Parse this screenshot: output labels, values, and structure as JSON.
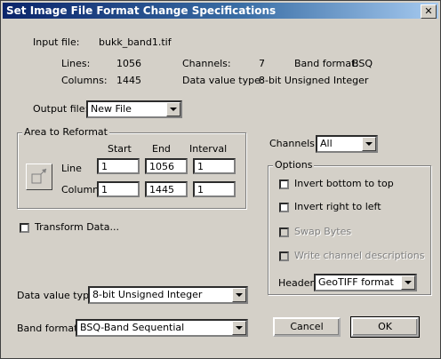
{
  "title": "Set Image File Format Change Specifications",
  "input_file": {
    "label": "Input file:",
    "value": "bukk_band1.tif"
  },
  "info": {
    "lines_label": "Lines:",
    "lines_value": "1056",
    "channels_label": "Channels:",
    "channels_value": "7",
    "band_format_label": "Band format:",
    "band_format_value": "BSQ",
    "columns_label": "Columns:",
    "columns_value": "1445",
    "data_value_type_label": "Data value type:",
    "data_value_type_value": "8-bit Unsigned Integer"
  },
  "output_file": {
    "label": "Output file:",
    "value": "New File"
  },
  "area": {
    "title": "Area to Reformat",
    "start_header": "Start",
    "end_header": "End",
    "interval_header": "Interval",
    "line_label": "Line",
    "line_start": "1",
    "line_end": "1056",
    "line_interval": "1",
    "column_label": "Column",
    "column_start": "1",
    "column_end": "1445",
    "column_interval": "1"
  },
  "channels": {
    "label": "Channels:",
    "value": "All"
  },
  "options": {
    "title": "Options",
    "invert_bottom": "Invert bottom to top",
    "invert_right": "Invert right to left",
    "swap_bytes": "Swap Bytes",
    "write_channel": "Write channel descriptions",
    "header_label": "Header:",
    "header_value": "GeoTIFF format"
  },
  "transform_data": "Transform Data...",
  "data_value_type": {
    "label": "Data value type:",
    "value": "8-bit Unsigned Integer"
  },
  "band_format": {
    "label": "Band format:",
    "value": "BSQ-Band Sequential"
  },
  "buttons": {
    "cancel": "Cancel",
    "ok": "OK"
  },
  "icons": {
    "close": "close-icon",
    "reformat": "area-reformat-icon"
  },
  "colors": {
    "titlebar_start": "#0a246a",
    "titlebar_end": "#a6caf0",
    "face": "#d4d0c8"
  }
}
